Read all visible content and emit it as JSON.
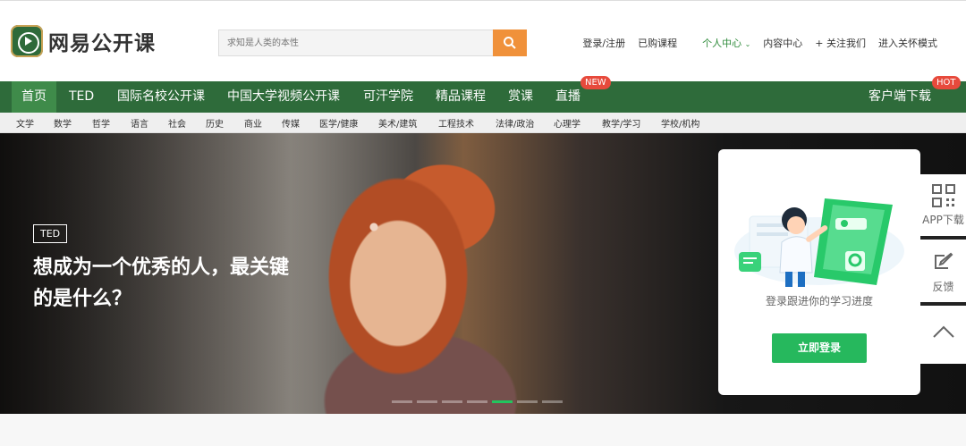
{
  "brand": {
    "name": "网易公开课"
  },
  "search": {
    "placeholder": "求知是人类的本性"
  },
  "header": {
    "links": [
      {
        "label": "登录/注册"
      },
      {
        "label": "已购课程"
      },
      {
        "label": "个人中心",
        "chevron": true,
        "active": true
      },
      {
        "label": "内容中心"
      },
      {
        "label": "+ 关注我们"
      },
      {
        "label": "进入关怀模式"
      }
    ]
  },
  "nav": {
    "items": [
      {
        "label": "首页",
        "active": true
      },
      {
        "label": "TED"
      },
      {
        "label": "国际名校公开课"
      },
      {
        "label": "中国大学视频公开课"
      },
      {
        "label": "可汗学院"
      },
      {
        "label": "精品课程"
      },
      {
        "label": "赏课"
      },
      {
        "label": "直播",
        "badge": "NEW"
      },
      {
        "label": "客户端下载",
        "badge": "HOT"
      }
    ]
  },
  "categories": [
    "文学",
    "数学",
    "哲学",
    "语言",
    "社会",
    "历史",
    "商业",
    "传媒",
    "医学/健康",
    "美术/建筑",
    "工程技术",
    "法律/政治",
    "心理学",
    "教学/学习",
    "学校/机构"
  ],
  "hero": {
    "tag": "TED",
    "title": "想成为一个优秀的人，最关键的是什么？",
    "slides": 7,
    "active_slide": 5
  },
  "login": {
    "prompt": "登录跟进你的学习进度",
    "button": "立即登录"
  },
  "sidebar": {
    "app_download": "APP下载",
    "feedback": "反馈"
  },
  "colors": {
    "nav": "#2e6b3a",
    "search_button": "#f0913a",
    "login_button": "#26b85d",
    "badge": "#e74a3c"
  }
}
